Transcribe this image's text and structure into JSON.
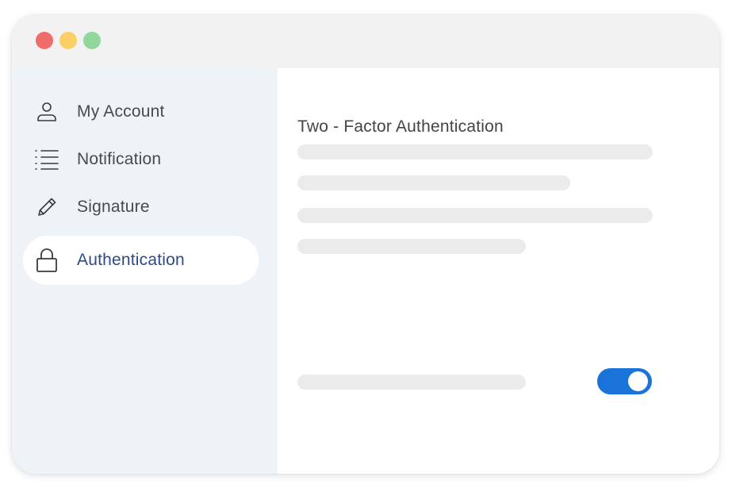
{
  "window": {
    "controls": [
      {
        "name": "close",
        "color": "#f06b6b"
      },
      {
        "name": "minimize",
        "color": "#fbcf63"
      },
      {
        "name": "maximize",
        "color": "#8fd79a"
      }
    ]
  },
  "sidebar": {
    "items": [
      {
        "label": "My Account",
        "icon": "user-icon",
        "active": false
      },
      {
        "label": "Notification",
        "icon": "list-icon",
        "active": false
      },
      {
        "label": "Signature",
        "icon": "pencil-icon",
        "active": false
      },
      {
        "label": "Authentication",
        "icon": "lock-icon",
        "active": true
      }
    ]
  },
  "main": {
    "title": "Two - Factor Authentication",
    "two_factor_toggle": {
      "on": true
    },
    "colors": {
      "accent": "#1a73d9",
      "active_label": "#2e4a8a",
      "sidebar_bg": "#eef3f8",
      "placeholder": "#ebebeb"
    }
  }
}
